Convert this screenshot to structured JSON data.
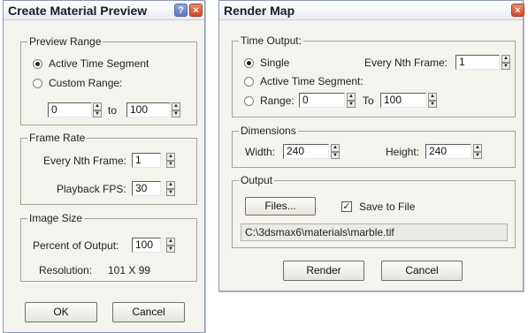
{
  "preview_dialog": {
    "title": "Create Material Preview",
    "help_glyph": "?",
    "close_glyph": "×",
    "preview_range": {
      "label": "Preview Range",
      "active_time_segment": "Active Time Segment",
      "custom_range": "Custom Range:",
      "selected": "Active Time Segment",
      "range_start": "0",
      "to_label": "to",
      "range_end": "100"
    },
    "frame_rate": {
      "label": "Frame Rate",
      "every_nth_label": "Every Nth Frame:",
      "every_nth_value": "1",
      "playback_fps_label": "Playback FPS:",
      "playback_fps_value": "30"
    },
    "image_size": {
      "label": "Image Size",
      "percent_label": "Percent of Output:",
      "percent_value": "100",
      "resolution_label": "Resolution:",
      "resolution_value": "101 X 99"
    },
    "ok_label": "OK",
    "cancel_label": "Cancel"
  },
  "render_dialog": {
    "title": "Render Map",
    "close_glyph": "×",
    "time_output": {
      "label": "Time Output:",
      "single": "Single",
      "every_nth_label": "Every Nth Frame:",
      "every_nth_value": "1",
      "active_time_segment": "Active Time Segment:",
      "range_label": "Range:",
      "range_start": "0",
      "to_label": "To",
      "range_end": "100",
      "selected": "Single"
    },
    "dimensions": {
      "label": "Dimensions",
      "width_label": "Width:",
      "width_value": "240",
      "height_label": "Height:",
      "height_value": "240"
    },
    "output": {
      "label": "Output",
      "files_button": "Files...",
      "save_to_file_label": "Save to File",
      "save_to_file_checked": true,
      "check_glyph": "✓",
      "path": "C:\\3dsmax6\\materials\\marble.tif"
    },
    "render_label": "Render",
    "cancel_label": "Cancel"
  },
  "icons": {
    "spinner_up": "▲",
    "spinner_down": "▼"
  }
}
